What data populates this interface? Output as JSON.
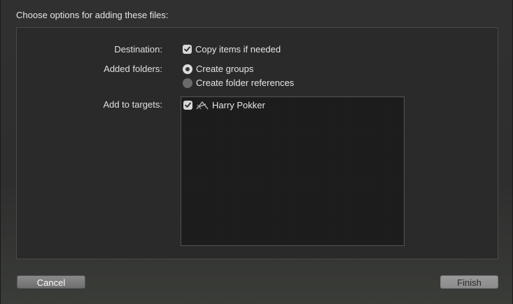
{
  "dialog": {
    "header": "Choose options for adding these files:"
  },
  "destination": {
    "label": "Destination:",
    "copy_items": {
      "label": "Copy items if needed",
      "checked": true
    }
  },
  "added_folders": {
    "label": "Added folders:",
    "options": [
      {
        "label": "Create groups",
        "selected": true
      },
      {
        "label": "Create folder references",
        "selected": false
      }
    ]
  },
  "targets": {
    "label": "Add to targets:",
    "items": [
      {
        "label": "Harry Pokker",
        "checked": true,
        "icon": "app-target-icon"
      }
    ]
  },
  "buttons": {
    "cancel": "Cancel",
    "finish": "Finish"
  },
  "colors": {
    "background": "#2b2b2b",
    "panel": "#2a2a2a",
    "list_background": "#1c1c1c",
    "text": "#e6e6e6"
  }
}
